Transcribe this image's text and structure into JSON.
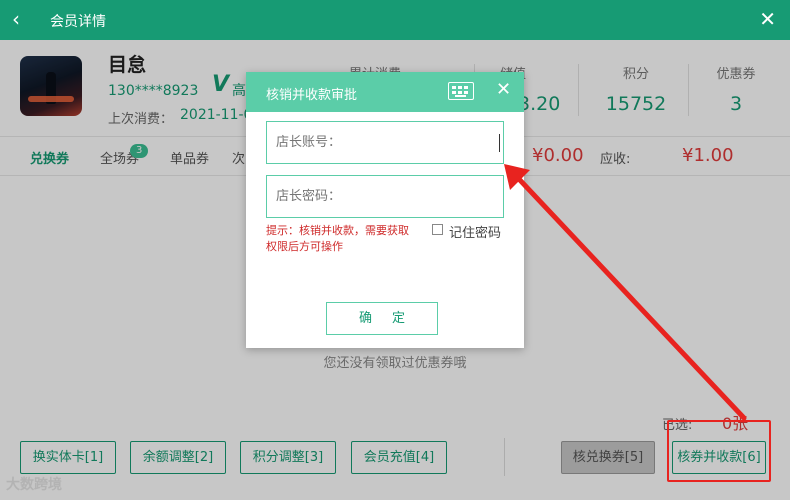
{
  "window": {
    "title": "会员详情",
    "back_glyph": "‹",
    "close_glyph": "✕"
  },
  "member": {
    "name": "目怠",
    "phone": "130****8923",
    "vip_mark": "V",
    "vip_text": "高",
    "last_spend_label": "上次消费：",
    "last_spend_value": "2021-11-0"
  },
  "stats": [
    {
      "label": "累计消费",
      "value": ""
    },
    {
      "label": "储值",
      "value": "3.20"
    },
    {
      "label": "积分",
      "value": "15752"
    },
    {
      "label": "优惠券",
      "value": "3"
    }
  ],
  "coupon_tabs": [
    {
      "label": "兑换券"
    },
    {
      "label": "全场券"
    },
    {
      "label": "单品券"
    },
    {
      "label": "次"
    }
  ],
  "coupon_badge": "3",
  "amounts": {
    "deduct_value": "¥0.00",
    "receivable_label": "应收:",
    "receivable_value": "¥1.00"
  },
  "empty_message": "您还没有领取过优惠券哦",
  "selected": {
    "label": "已选:",
    "value": "0张"
  },
  "bottom_buttons": [
    {
      "label": "换实体卡[1]"
    },
    {
      "label": "余额调整[2]"
    },
    {
      "label": "积分调整[3]"
    },
    {
      "label": "会员充值[4]"
    }
  ],
  "redeem_button": "核兑换券[5]",
  "verify_button": "核券并收款[6]",
  "watermark": "大数跨境",
  "dialog": {
    "title": "核销并收款审批",
    "keyboard_icon": "keyboard-icon",
    "close_glyph": "✕",
    "account_placeholder": "店长账号：",
    "account_value": "",
    "password_placeholder": "店长密码：",
    "password_value": "",
    "hint": "提示：核销并收款，需要获取权限后方可操作",
    "remember_label": "记住密码",
    "remember_checked": false,
    "confirm_label": "确定"
  },
  "colors": {
    "brand": "#179b74",
    "dialog_header": "#5bcda8",
    "alert": "#e8231f",
    "price": "#e03b3b"
  }
}
